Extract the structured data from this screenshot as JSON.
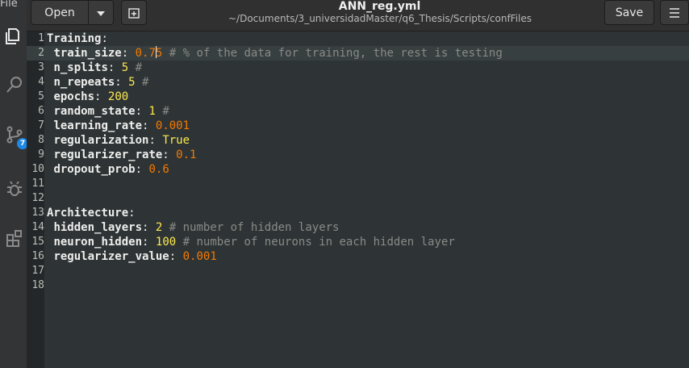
{
  "app": {
    "menu_file": "File",
    "title": "ANN_reg.yml",
    "path": "~/Documents/3_universidadMaster/q6_Thesis/Scripts/confFiles",
    "open_label": "Open",
    "save_label": "Save"
  },
  "activity": {
    "icons": [
      "files-icon",
      "search-icon",
      "source-control-icon",
      "debug-icon",
      "extensions-icon"
    ],
    "source_control_badge": "7"
  },
  "editor": {
    "current_line": 2,
    "lines": [
      {
        "num": "1",
        "key": "Training",
        "value": "",
        "vtype": "",
        "comment": "",
        "indent": ""
      },
      {
        "num": "2",
        "key": "train_size",
        "value": "0.75",
        "vtype": "n",
        "comment": "# % of the data for training, the rest is testing",
        "indent": " "
      },
      {
        "num": "3",
        "key": "n_splits",
        "value": "5",
        "vtype": "b",
        "comment": "#",
        "indent": " "
      },
      {
        "num": "4",
        "key": "n_repeats",
        "value": "5",
        "vtype": "b",
        "comment": "#",
        "indent": " "
      },
      {
        "num": "5",
        "key": "epochs",
        "value": "200",
        "vtype": "b",
        "comment": "",
        "indent": " "
      },
      {
        "num": "6",
        "key": "random_state",
        "value": "1",
        "vtype": "b",
        "comment": "#",
        "indent": " "
      },
      {
        "num": "7",
        "key": "learning_rate",
        "value": "0.001",
        "vtype": "n",
        "comment": "",
        "indent": " "
      },
      {
        "num": "8",
        "key": "regularization",
        "value": "True",
        "vtype": "b",
        "comment": "",
        "indent": " "
      },
      {
        "num": "9",
        "key": "regularizer_rate",
        "value": "0.1",
        "vtype": "n",
        "comment": "",
        "indent": " "
      },
      {
        "num": "10",
        "key": "dropout_prob",
        "value": "0.6",
        "vtype": "n",
        "comment": "",
        "indent": " "
      },
      {
        "num": "11",
        "key": "",
        "value": "",
        "vtype": "",
        "comment": "",
        "indent": ""
      },
      {
        "num": "12",
        "key": "",
        "value": "",
        "vtype": "",
        "comment": "",
        "indent": ""
      },
      {
        "num": "13",
        "key": "Architecture",
        "value": "",
        "vtype": "",
        "comment": "",
        "indent": ""
      },
      {
        "num": "14",
        "key": "hidden_layers",
        "value": "2",
        "vtype": "b",
        "comment": "# number of hidden layers",
        "indent": " "
      },
      {
        "num": "15",
        "key": "neuron_hidden",
        "value": "100",
        "vtype": "b",
        "comment": "# number of neurons in each hidden layer",
        "indent": " "
      },
      {
        "num": "16",
        "key": "regularizer_value",
        "value": "0.001",
        "vtype": "n",
        "comment": "",
        "indent": " "
      },
      {
        "num": "17",
        "key": "",
        "value": "",
        "vtype": "",
        "comment": "",
        "indent": ""
      },
      {
        "num": "18",
        "key": "",
        "value": "",
        "vtype": "",
        "comment": "",
        "indent": ""
      }
    ]
  }
}
